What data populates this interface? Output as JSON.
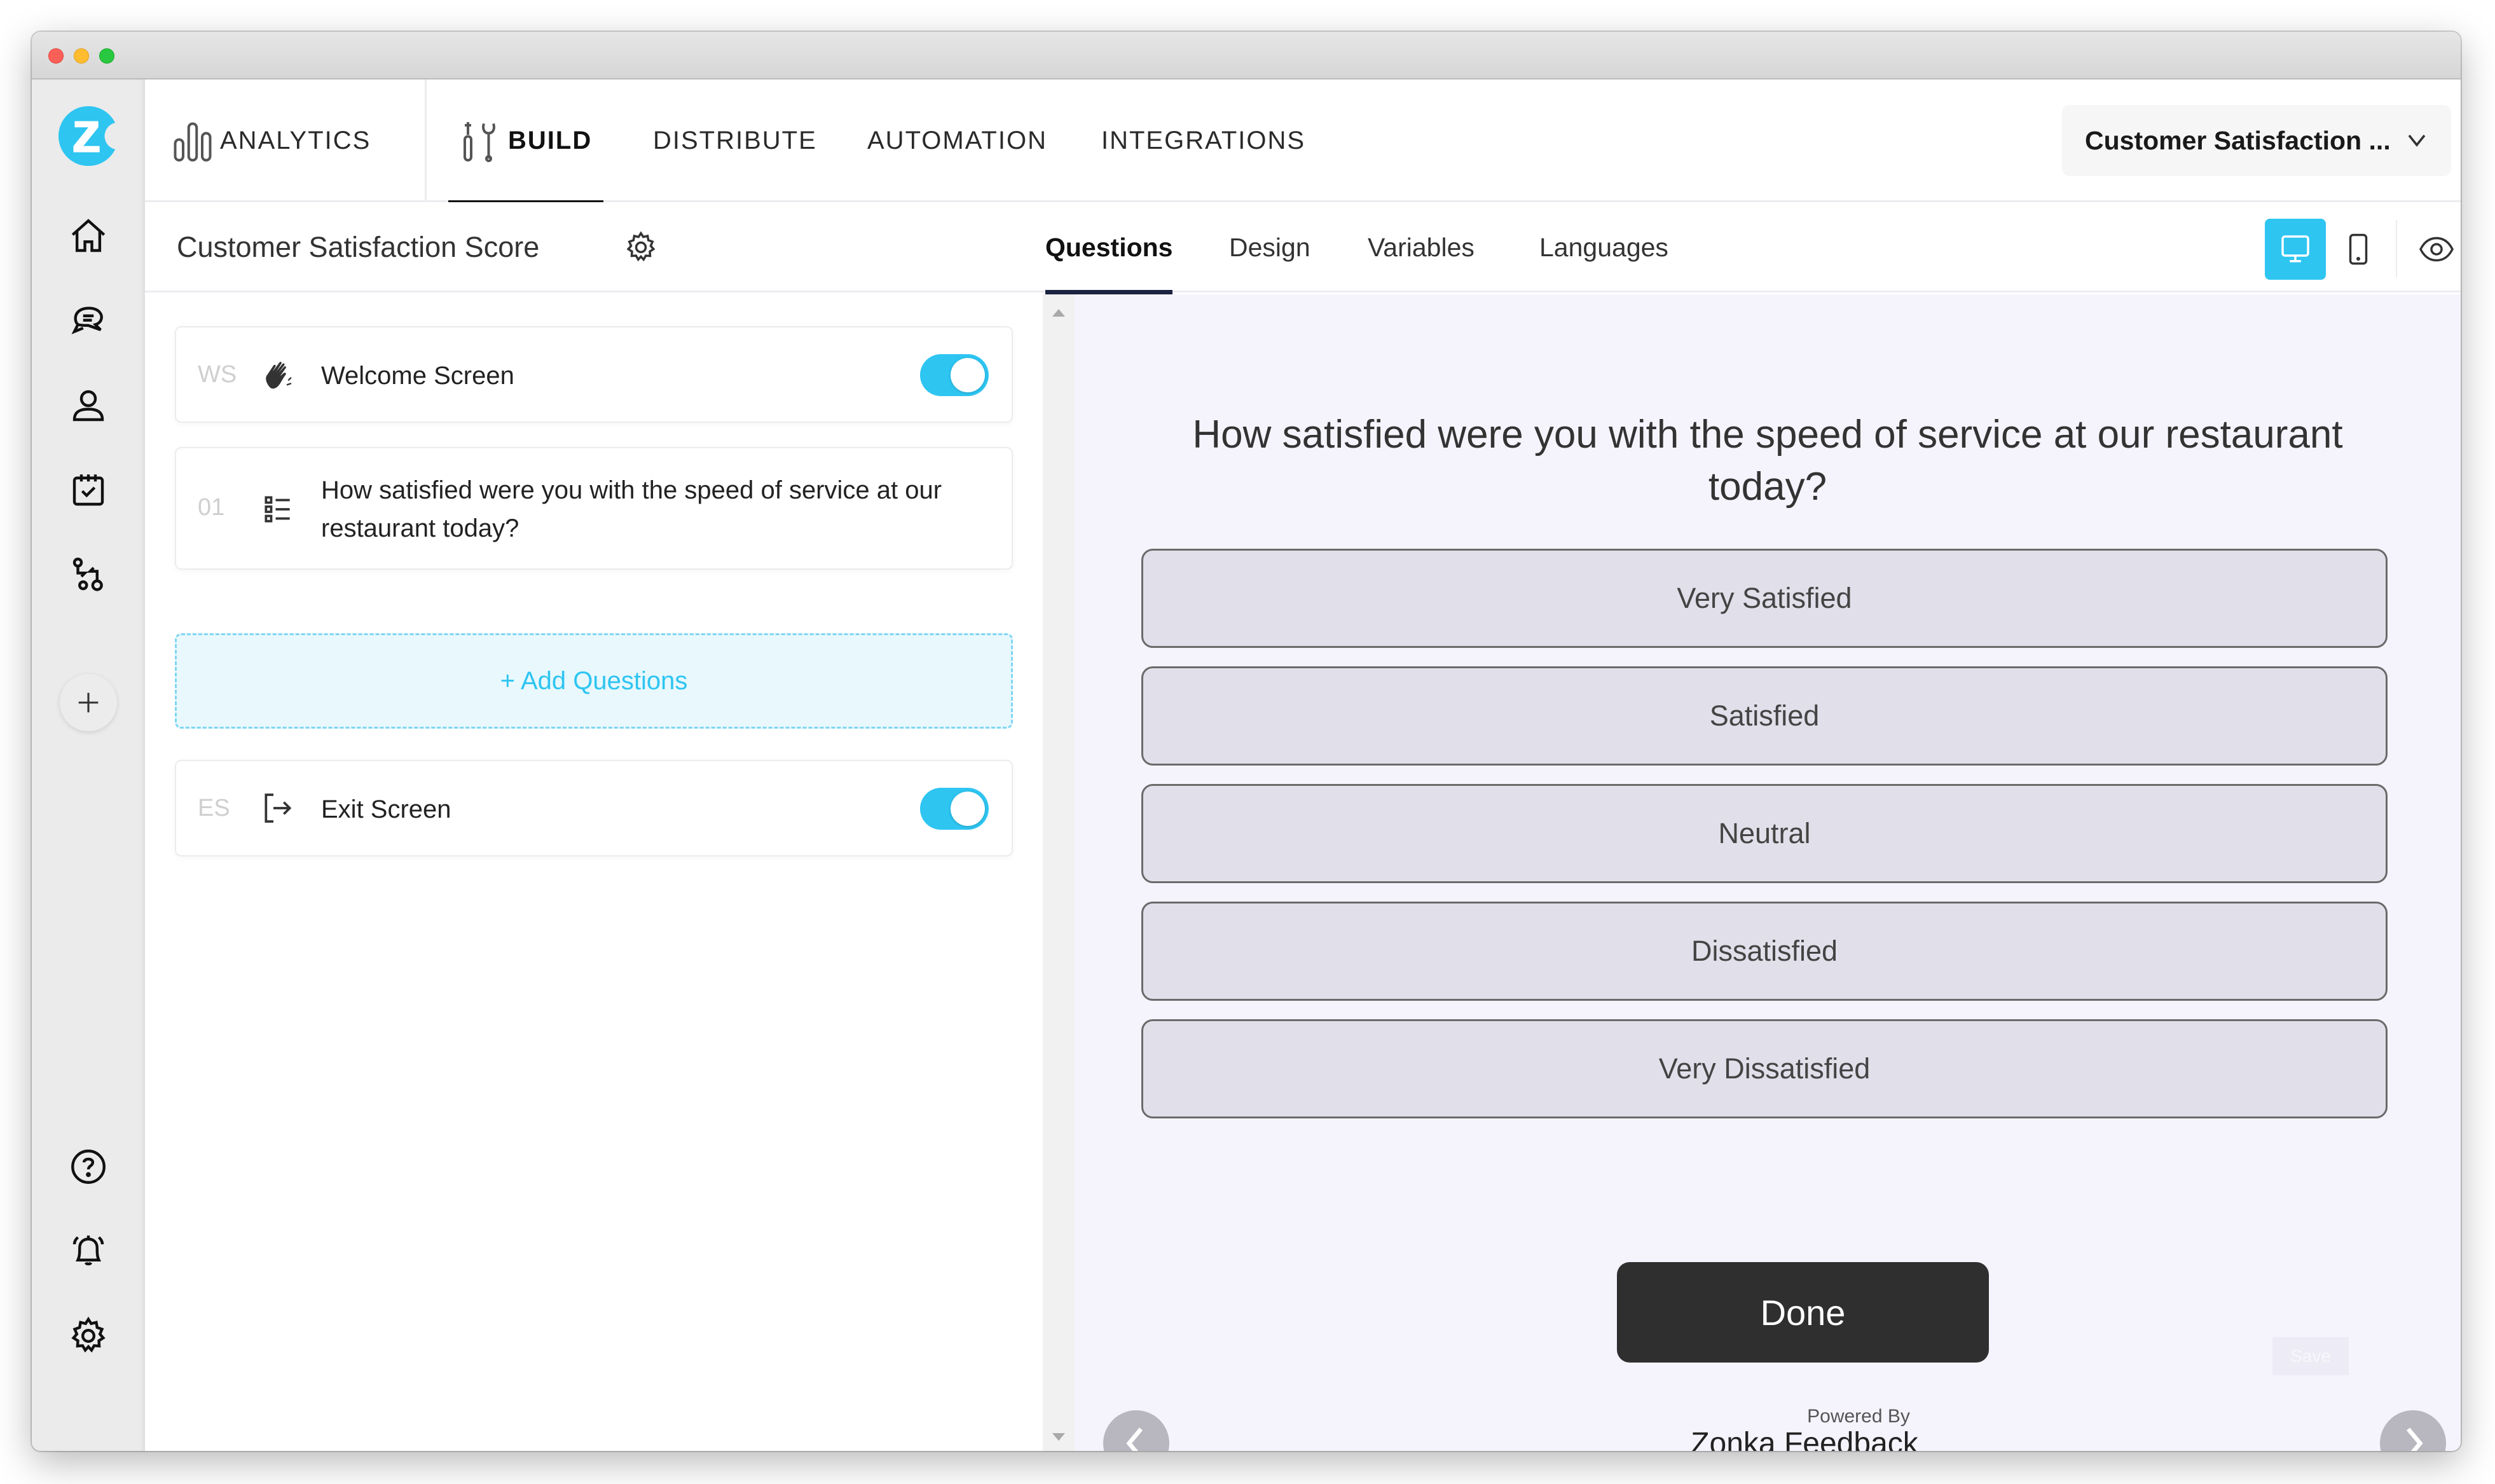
{
  "window": {
    "controls": [
      "close",
      "minimize",
      "maximize"
    ]
  },
  "sidebar": {
    "logo_letter": "Z",
    "brand_color": "#2ec5f1",
    "top_items": [
      {
        "name": "home",
        "icon": "home-icon"
      },
      {
        "name": "conversations",
        "icon": "chat-bubbles-icon"
      },
      {
        "name": "contacts",
        "icon": "user-icon"
      },
      {
        "name": "tasks",
        "icon": "calendar-check-icon"
      },
      {
        "name": "workflows",
        "icon": "workflow-icon"
      }
    ],
    "add_icon": "plus-icon",
    "bottom_items": [
      {
        "name": "help",
        "icon": "help-circle-icon"
      },
      {
        "name": "notifications",
        "icon": "bell-ringing-icon"
      },
      {
        "name": "settings",
        "icon": "gear-icon"
      }
    ]
  },
  "topnav": {
    "items": [
      {
        "label": "ANALYTICS",
        "icon": "analytics-bars-icon",
        "active": false
      },
      {
        "label": "BUILD",
        "icon": "build-tools-icon",
        "active": true
      },
      {
        "label": "DISTRIBUTE",
        "active": false
      },
      {
        "label": "AUTOMATION",
        "active": false
      },
      {
        "label": "INTEGRATIONS",
        "active": false
      }
    ],
    "survey_selector": {
      "value": "Customer Satisfaction ...",
      "icon": "chevron-down-icon"
    }
  },
  "subheader": {
    "survey_title": "Customer Satisfaction Score",
    "tabs": [
      {
        "label": "Questions",
        "active": true
      },
      {
        "label": "Design",
        "active": false
      },
      {
        "label": "Variables",
        "active": false
      },
      {
        "label": "Languages",
        "active": false
      }
    ],
    "view_modes": [
      {
        "name": "desktop",
        "icon": "desktop-icon",
        "active": true
      },
      {
        "name": "mobile",
        "icon": "mobile-icon",
        "active": false
      }
    ],
    "preview_icon": "eye-icon"
  },
  "builder": {
    "cards": [
      {
        "code": "WS",
        "icon": "waving-hand-icon",
        "label": "Welcome Screen",
        "toggle": true
      },
      {
        "code": "01",
        "icon": "list-choice-icon",
        "label": "How satisfied were you with the speed of service at our restaurant today?"
      },
      {
        "code": "ES",
        "icon": "exit-icon",
        "label": "Exit Screen",
        "toggle": true
      }
    ],
    "add_questions_label": "+ Add Questions"
  },
  "preview": {
    "question": "How satisfied were you with the speed of service at our restaurant today?",
    "choices": [
      "Very Satisfied",
      "Satisfied",
      "Neutral",
      "Dissatisfied",
      "Very Dissatisfied"
    ],
    "done_label": "Done",
    "save_label": "Save",
    "powered_by": "Powered By",
    "brand": "Zonka Feedback"
  }
}
